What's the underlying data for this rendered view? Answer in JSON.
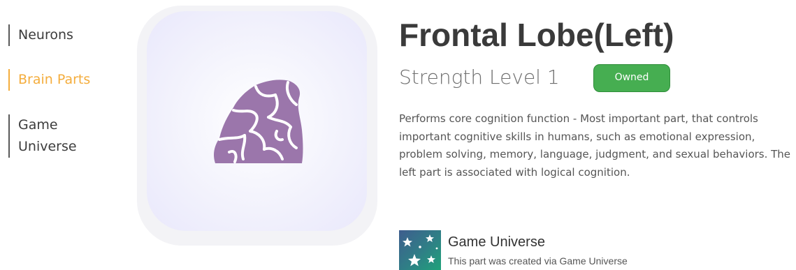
{
  "sidebar": {
    "items": [
      {
        "label": "Neurons",
        "active": false
      },
      {
        "label": "Brain Parts",
        "active": true
      },
      {
        "label": "Game Universe",
        "active": false
      }
    ]
  },
  "part": {
    "title": "Frontal Lobe(Left)",
    "level": "Strength Level 1",
    "badge": "Owned",
    "icon": "brain-lobe-icon",
    "description": "Performs core cognition function - Most important part, that controls important cognitive skills in humans, such as emotional expression, problem solving, memory, language, judgment, and sexual behaviors. The left part is associated with logical cognition."
  },
  "source": {
    "icon": "stars-icon",
    "title": "Game Universe",
    "caption": "This part was created via Game Universe"
  },
  "colors": {
    "accent": "#f4ad3d",
    "owned": "#46ae51",
    "brain": "#9b76ab"
  }
}
